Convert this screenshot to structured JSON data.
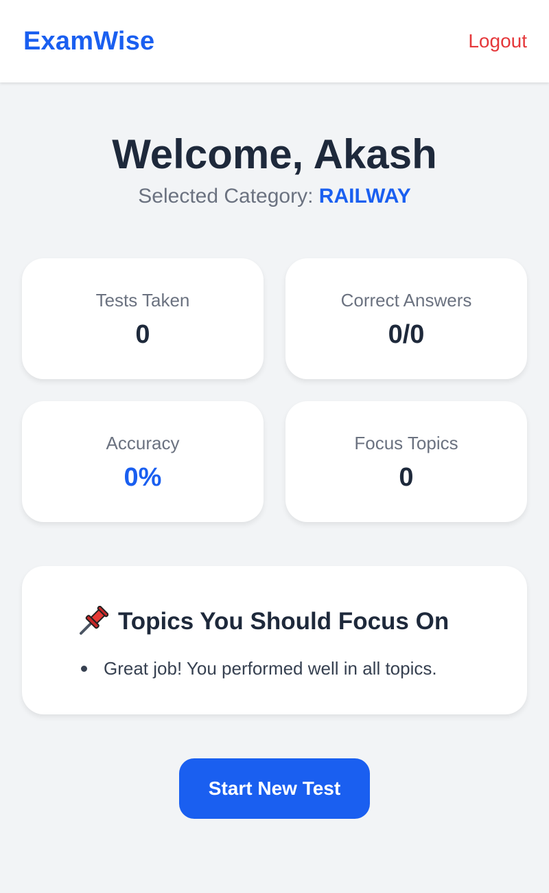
{
  "navbar": {
    "brand": "ExamWise",
    "logout_label": "Logout"
  },
  "hero": {
    "welcome": "Welcome, Akash",
    "category_label": "Selected Category:",
    "category_value": "RAILWAY"
  },
  "stats": [
    {
      "label": "Tests Taken",
      "value": "0"
    },
    {
      "label": "Correct Answers",
      "value": "0/0"
    },
    {
      "label": "Accuracy",
      "value": "0%"
    },
    {
      "label": "Focus Topics",
      "value": "0"
    }
  ],
  "focus": {
    "icon": "pushpin-icon",
    "title": "Topics You Should Focus On",
    "items": [
      "Great job! You performed well in all topics."
    ]
  },
  "actions": {
    "start_label": "Start New Test"
  },
  "colors": {
    "accent": "#1a5ff0",
    "logout": "#e5383b",
    "background": "#f2f4f6"
  }
}
